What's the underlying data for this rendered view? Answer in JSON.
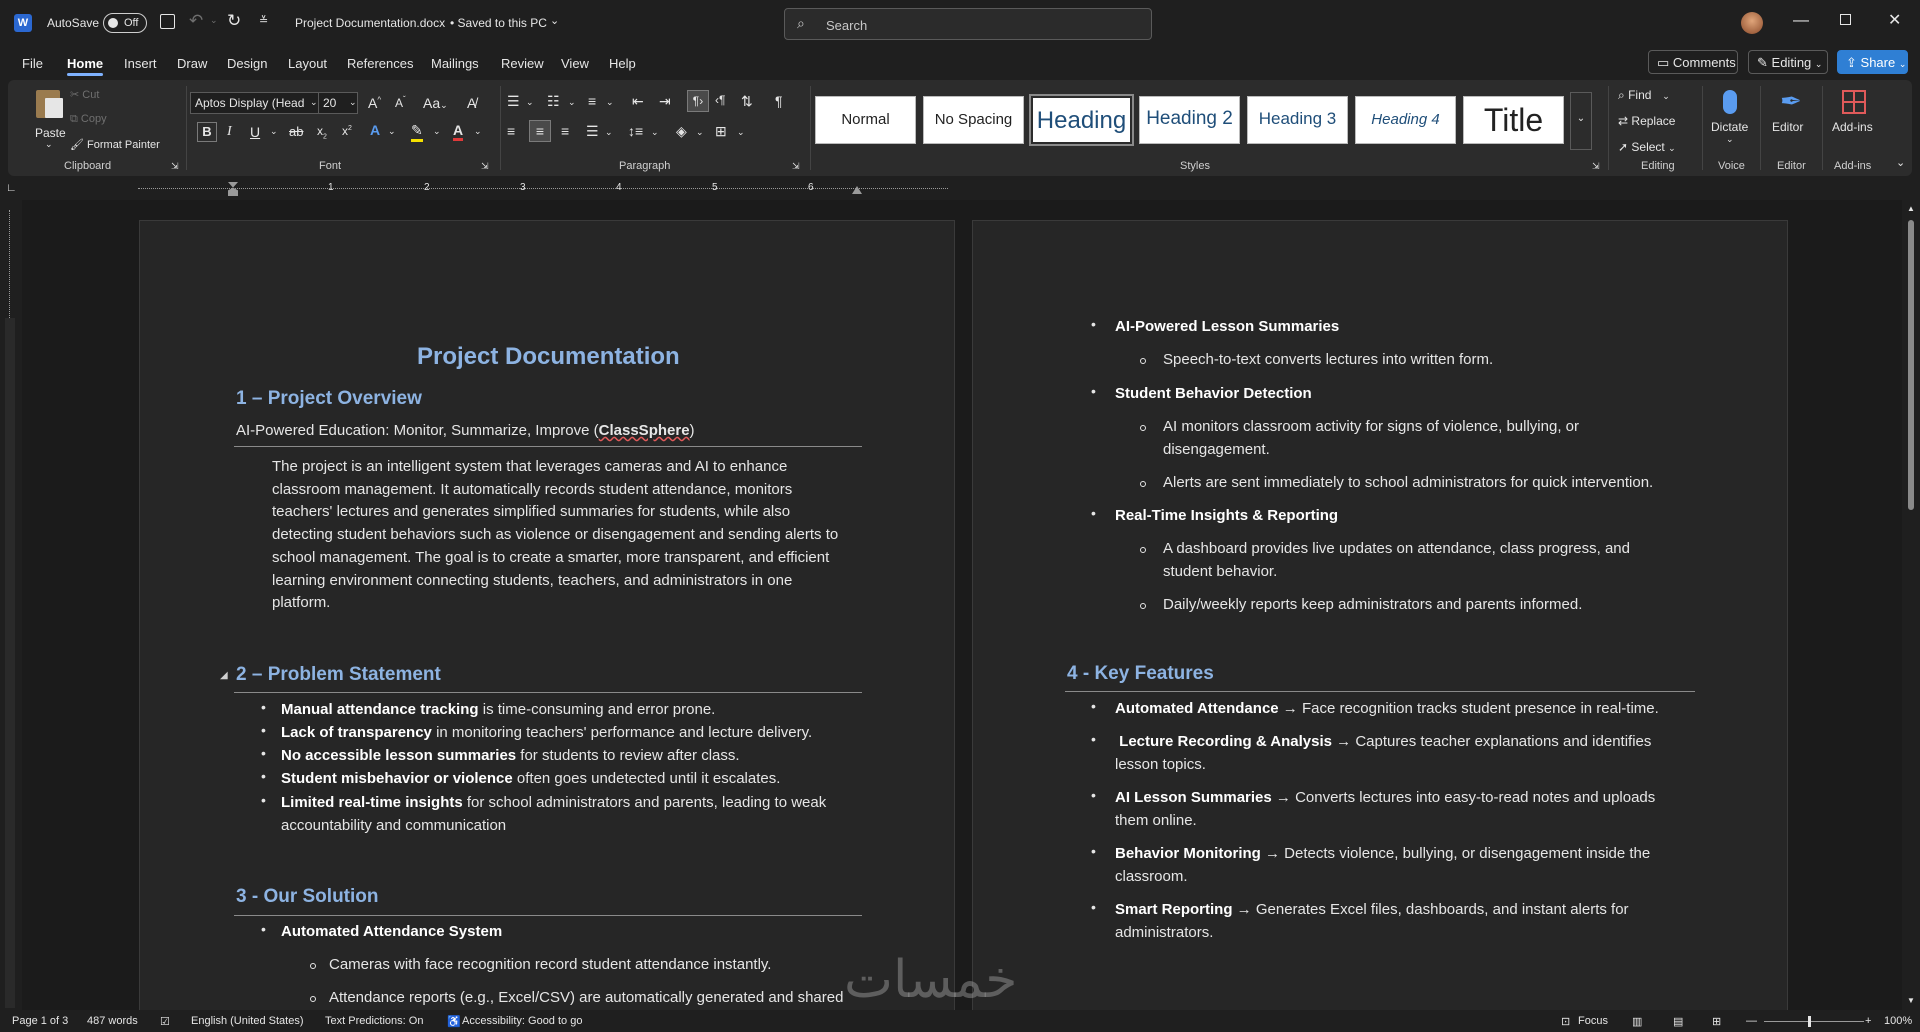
{
  "titlebar": {
    "app_icon": "word-icon",
    "autosave_label": "AutoSave",
    "autosave_state": "Off",
    "document_title": "Project Documentation.docx",
    "save_status": "• Saved to this PC",
    "search_placeholder": "Search",
    "window_controls": [
      "minimize-icon",
      "restore-icon",
      "close-icon"
    ]
  },
  "menu": {
    "tabs": [
      "File",
      "Home",
      "Insert",
      "Draw",
      "Design",
      "Layout",
      "References",
      "Mailings",
      "Review",
      "View",
      "Help"
    ],
    "active_tab": "Home",
    "comments_label": "Comments",
    "editing_label": "Editing",
    "share_label": "Share"
  },
  "ribbon": {
    "clipboard": {
      "paste": "Paste",
      "cut": "Cut",
      "copy": "Copy",
      "format_painter": "Format Painter",
      "group_label": "Clipboard"
    },
    "font": {
      "font_name": "Aptos Display (Head",
      "font_size": "20",
      "group_label": "Font"
    },
    "paragraph": {
      "group_label": "Paragraph"
    },
    "styles": {
      "items": [
        "Normal",
        "No Spacing",
        "Heading",
        "Heading 2",
        "Heading 3",
        "Heading 4",
        "Title"
      ],
      "selected": "Heading",
      "group_label": "Styles"
    },
    "editing": {
      "find": "Find",
      "replace": "Replace",
      "select": "Select",
      "group_label": "Editing"
    },
    "voice": {
      "dictate": "Dictate",
      "group_label": "Voice"
    },
    "editor": {
      "editor": "Editor",
      "group_label": "Editor"
    },
    "addins": {
      "addins": "Add-ins",
      "group_label": "Add-ins"
    }
  },
  "ruler": {
    "marks": [
      "1",
      "2",
      "3",
      "4",
      "5",
      "6"
    ]
  },
  "page1": {
    "title": "Project Documentation",
    "section1": {
      "heading": "1 – Project Overview",
      "subtitle_prefix": "AI-Powered Education: Monitor, Summarize, Improve (",
      "subtitle_brand": "ClassSphere",
      "subtitle_suffix": ")",
      "body_lines": [
        "The project is an intelligent system that leverages cameras and AI to enhance",
        "classroom management. It automatically records student attendance, monitors",
        "teachers' lectures and generates simplified summaries for students, while also",
        "detecting student behaviors such as violence or disengagement and sending alerts to",
        "school management. The goal is to create a smarter, more transparent, and efficient",
        "learning environment connecting students, teachers, and administrators in one",
        "platform."
      ]
    },
    "section2": {
      "heading": "2 – Problem Statement",
      "items": [
        {
          "bold": "Manual attendance tracking",
          "rest": " is time-consuming and error prone."
        },
        {
          "bold": "Lack of transparency",
          "rest": " in monitoring teachers' performance and lecture delivery."
        },
        {
          "bold": "No accessible lesson summaries",
          "rest": " for students to review after class."
        },
        {
          "bold": "Student misbehavior or violence",
          "rest": " often goes undetected until it escalates."
        },
        {
          "bold": "Limited real-time insights",
          "rest": " for school administrators and parents, leading to weak"
        }
      ],
      "item5_line2": "accountability and communication"
    },
    "section3": {
      "heading": "3 - Our Solution",
      "item1": "Automated Attendance System",
      "sub1": "Cameras with face recognition record student attendance instantly.",
      "sub2": "Attendance reports (e.g., Excel/CSV) are automatically generated and shared"
    }
  },
  "page2": {
    "b1": "AI-Powered Lesson Summaries",
    "b1_sub1": "Speech-to-text converts lectures into written form.",
    "b2": "Student Behavior Detection",
    "b2_sub1_l1": "AI monitors classroom activity for signs of violence, bullying, or",
    "b2_sub1_l2": "disengagement.",
    "b2_sub2": "Alerts are sent immediately to school administrators for quick intervention.",
    "b3": "Real-Time Insights & Reporting",
    "b3_sub1_l1": "A dashboard provides live updates on attendance, class progress, and",
    "b3_sub1_l2": "student behavior.",
    "b3_sub2": "Daily/weekly reports keep administrators and parents informed.",
    "section4": {
      "heading": "4 - Key Features",
      "f1_bold": "Automated Attendance",
      "f1_rest": " → Face recognition tracks student presence in real-time.",
      "f2_bold": "Lecture Recording & Analysis",
      "f2_rest": " → Captures teacher explanations and identifies",
      "f2_l2": "lesson topics.",
      "f3_bold": "AI Lesson Summaries",
      "f3_rest": " → Converts lectures into easy-to-read notes and uploads",
      "f3_l2": "them online.",
      "f4_bold": "Behavior Monitoring",
      "f4_rest": " → Detects violence, bullying, or disengagement inside the",
      "f4_l2": "classroom.",
      "f5_bold": "Smart Reporting",
      "f5_rest": " → Generates Excel files, dashboards, and instant alerts for",
      "f5_l2": "administrators."
    }
  },
  "statusbar": {
    "page": "Page 1 of 3",
    "words": "487 words",
    "language": "English (United States)",
    "predictions": "Text Predictions: On",
    "accessibility": "Accessibility: Good to go",
    "focus": "Focus",
    "zoom": "100%"
  },
  "watermark": "خمسات"
}
